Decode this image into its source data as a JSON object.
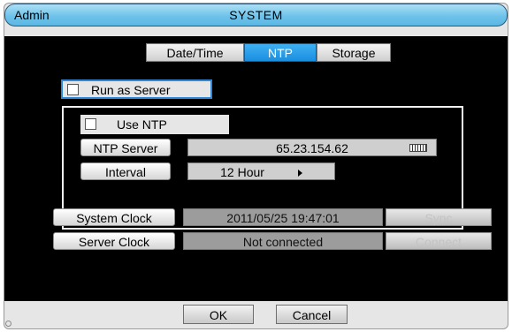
{
  "titlebar": {
    "user": "Admin",
    "title": "SYSTEM"
  },
  "tabs": [
    {
      "label": "Date/Time",
      "active": false
    },
    {
      "label": "NTP",
      "active": true
    },
    {
      "label": "Storage",
      "active": false
    }
  ],
  "run_as_server": {
    "label": "Run as Server",
    "checked": false
  },
  "ntp": {
    "use_ntp": {
      "label": "Use NTP",
      "checked": false
    },
    "server_label": "NTP Server",
    "server_value": "65.23.154.62",
    "interval_label": "Interval",
    "interval_value": "12 Hour"
  },
  "clocks": {
    "system_label": "System Clock",
    "system_value": "2011/05/25  19:47:01",
    "sync_label": "Sync",
    "server_label": "Server Clock",
    "server_value": "Not connected",
    "connect_label": "Connect"
  },
  "footer": {
    "ok_label": "OK",
    "cancel_label": "Cancel"
  },
  "colors": {
    "accent": "#1a8fe0",
    "titlebar": "#6ec3ea",
    "panel": "#000000"
  }
}
